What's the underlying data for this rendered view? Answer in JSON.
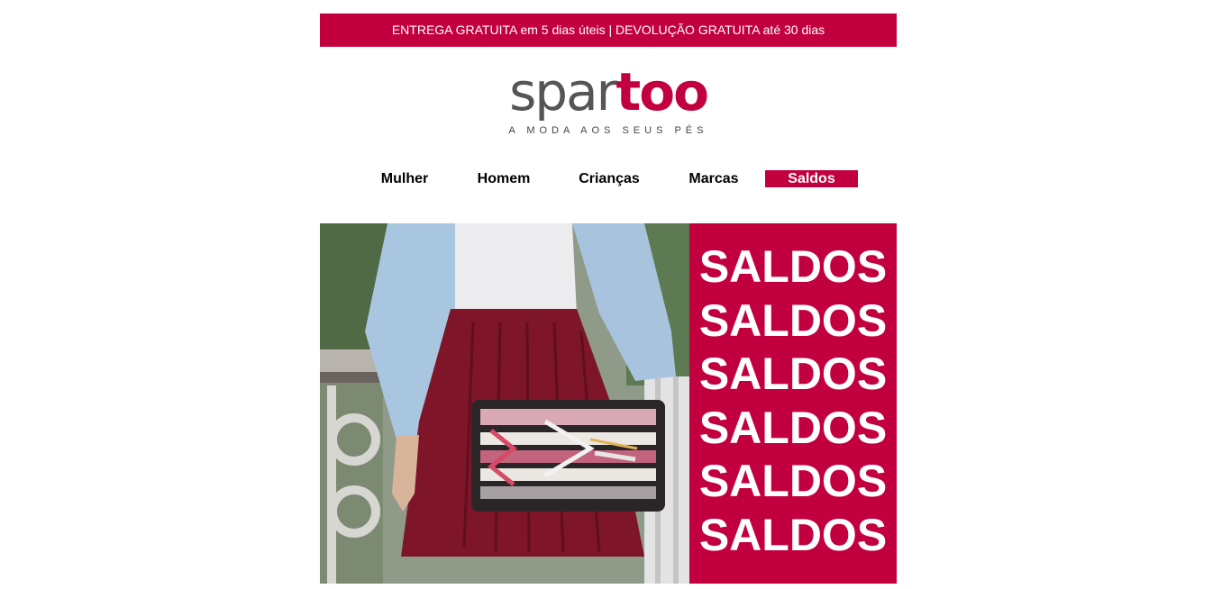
{
  "promo": {
    "text": "ENTREGA GRATUITA em 5 dias úteis | DEVOLUÇÃO GRATUITA até 30 dias"
  },
  "logo": {
    "part1": "spar",
    "part2": "too",
    "tagline": "A MODA AOS SEUS PÉS"
  },
  "nav": {
    "items": [
      {
        "label": "Mulher"
      },
      {
        "label": "Homem"
      },
      {
        "label": "Crianças"
      },
      {
        "label": "Marcas"
      },
      {
        "label": "Saldos"
      }
    ]
  },
  "hero": {
    "sale_words": [
      "SALDOS",
      "SALDOS",
      "SALDOS",
      "SALDOS",
      "SALDOS",
      "SALDOS"
    ]
  },
  "colors": {
    "brand": "#c3003f",
    "logo_gray": "#555555"
  }
}
